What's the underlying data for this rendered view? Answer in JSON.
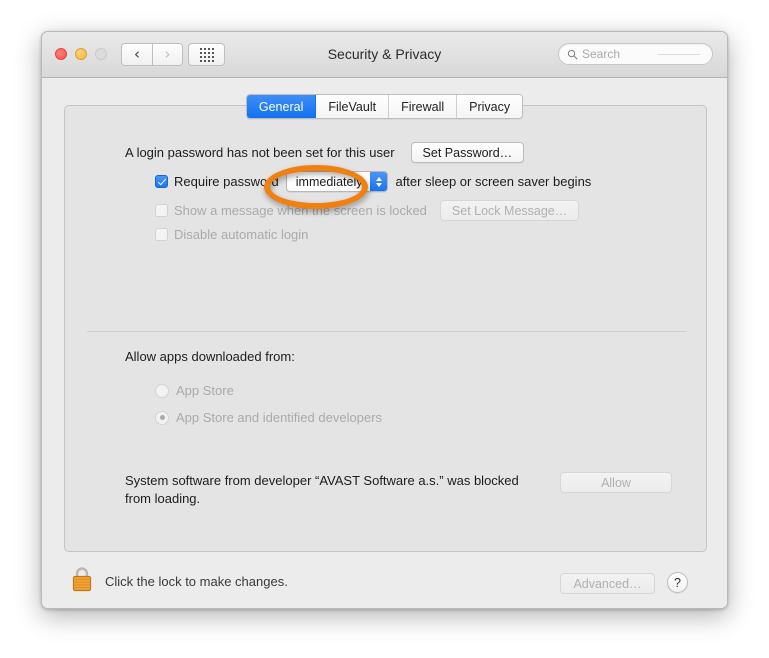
{
  "window": {
    "title": "Security & Privacy",
    "traffic_lights": [
      "close",
      "minimize",
      "zoom"
    ],
    "nav": {
      "back_icon": "chevron-left-icon",
      "forward_icon": "chevron-right-icon",
      "grid_icon": "grid-view-icon"
    },
    "search": {
      "placeholder": "Search",
      "icon": "search-icon"
    }
  },
  "tabs": [
    {
      "label": "General",
      "active": true
    },
    {
      "label": "FileVault",
      "active": false
    },
    {
      "label": "Firewall",
      "active": false
    },
    {
      "label": "Privacy",
      "active": false
    }
  ],
  "annotation": {
    "shape": "ellipse",
    "color": "#f08010",
    "target": "General"
  },
  "login": {
    "password_status": "A login password has not been set for this user",
    "set_password_button": "Set Password…",
    "require_password_label": "Require password",
    "require_password_checked": true,
    "delay_value": "immediately",
    "require_password_suffix": "after sleep or screen saver begins",
    "show_message_label": "Show a message when the screen is locked",
    "show_message_checked": false,
    "set_lock_message_button": "Set Lock Message…",
    "disable_auto_login_label": "Disable automatic login",
    "disable_auto_login_checked": false
  },
  "gatekeeper": {
    "heading": "Allow apps downloaded from:",
    "options": [
      {
        "label": "App Store",
        "selected": false
      },
      {
        "label": "App Store and identified developers",
        "selected": true
      }
    ]
  },
  "blocked": {
    "message_line1": "System software from developer “AVAST Software a.s.” was blocked",
    "message_line2": "from loading.",
    "allow_button": "Allow"
  },
  "bottom": {
    "lock_icon": "padlock-closed-icon",
    "lock_text": "Click the lock to make changes.",
    "advanced_button": "Advanced…",
    "help_button": "?"
  }
}
